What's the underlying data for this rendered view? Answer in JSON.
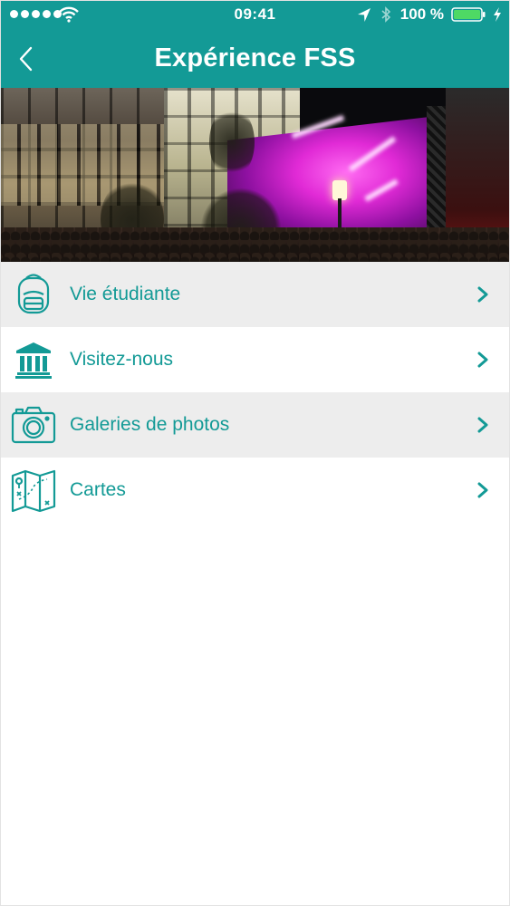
{
  "status_bar": {
    "time": "09:41",
    "battery": "100 %"
  },
  "header": {
    "title": "Expérience FSS",
    "back_icon": "chevron-left-icon"
  },
  "hero": {
    "description_icon": "concert-photo"
  },
  "menu": {
    "items": [
      {
        "label": "Vie étudiante",
        "icon": "backpack-icon"
      },
      {
        "label": "Visitez-nous",
        "icon": "building-icon"
      },
      {
        "label": "Galeries de photos",
        "icon": "camera-icon"
      },
      {
        "label": "Cartes",
        "icon": "map-icon"
      }
    ]
  },
  "colors": {
    "accent": "#139a96",
    "row_shade": "#ededed",
    "background": "#ffffff"
  }
}
